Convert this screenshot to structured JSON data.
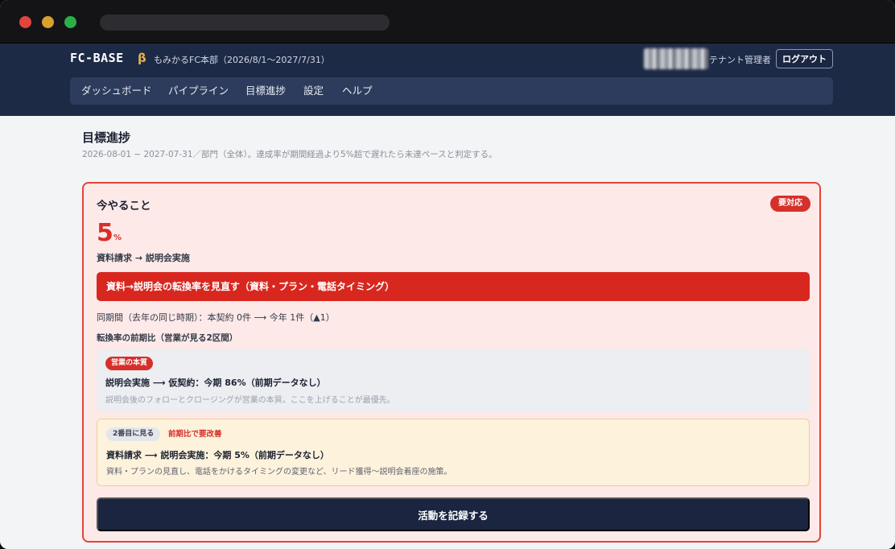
{
  "header": {
    "brand": "FC-BASE",
    "beta": "β",
    "org": "もみかるFC本部（2026/8/1〜2027/7/31）",
    "role": "テナント管理者",
    "logout": "ログアウト"
  },
  "nav": {
    "items": [
      "ダッシュボード",
      "パイプライン",
      "目標進捗",
      "設定",
      "ヘルプ"
    ]
  },
  "page": {
    "title": "目標進捗",
    "subtitle": "2026-08-01 ~ 2027-07-31／部門（全体）。達成率が期間経過より5%超で遅れたら未達ペースと判定する。"
  },
  "card": {
    "title": "今やること",
    "badge": "要対応",
    "value": "5",
    "unit": "%",
    "stage": "資料請求 → 説明会実施",
    "action": "資料→説明会の転換率を見直す（資料・プラン・電話タイミング）",
    "compare": "同期間（去年の同じ時期）：本契約 0件 ⟶ 今年 1件（▲1）",
    "section_label": "転換率の前期比（営業が見る2区間）",
    "box1": {
      "tag": "営業の本質",
      "line": "説明会実施 ⟶ 仮契約：今期 86%（前期データなし）",
      "note": "説明会後のフォローとクロージングが営業の本質。ここを上げることが最優先。"
    },
    "box2": {
      "tag": "2番目に見る",
      "flag": "前期比で要改善",
      "line": "資料請求 ⟶ 説明会実施：今期 5%（前期データなし）",
      "note": "資料・プランの見直し、電話をかけるタイミングの変更など、リード獲得〜説明会着座の施策。"
    },
    "record_button": "活動を記録する"
  },
  "colors": {
    "header_bg": "#1d2a46",
    "alert_red": "#d8271f",
    "card_bg": "#fde9e8",
    "warning_bg": "#fdf2dc",
    "primary_button": "#1b2540",
    "brand_beta": "#e8b245"
  }
}
